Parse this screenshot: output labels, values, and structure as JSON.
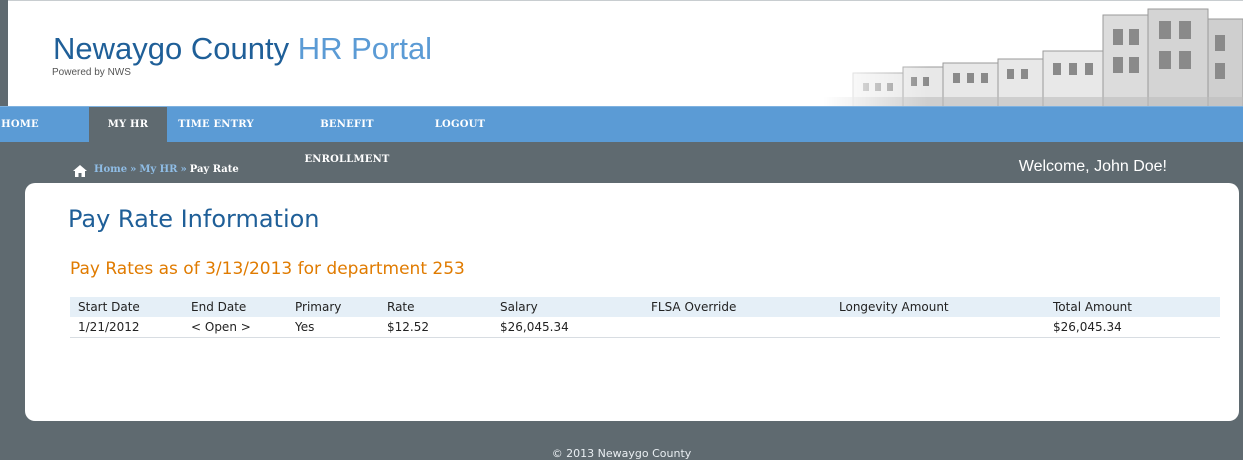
{
  "header": {
    "title_part1": "Newaygo County",
    "title_part2": "HR Portal",
    "powered_by": "Powered by NWS"
  },
  "nav": {
    "items": [
      {
        "label": "HOME"
      },
      {
        "label": "MY HR"
      },
      {
        "label": "TIME ENTRY"
      },
      {
        "label": "BENEFIT ENROLLMENT"
      },
      {
        "label": "LOGOUT"
      }
    ],
    "active": "MY HR"
  },
  "breadcrumb": {
    "home": "Home",
    "myhr": "My HR",
    "current": "Pay Rate",
    "sep": "»"
  },
  "welcome": "Welcome, John Doe!",
  "main": {
    "page_title": "Pay Rate Information",
    "section_title": "Pay Rates as of 3/13/2013 for department 253",
    "table": {
      "headers": [
        "Start Date",
        "End Date",
        "Primary",
        "Rate",
        "Salary",
        "FLSA Override",
        "Longevity Amount",
        "Total Amount"
      ],
      "rows": [
        [
          "1/21/2012",
          "< Open >",
          "Yes",
          "$12.52",
          "$26,045.34",
          "",
          "",
          "$26,045.34"
        ]
      ]
    }
  },
  "footer": "© 2013 Newaygo County",
  "colors": {
    "nav_bg": "#5b9bd5",
    "page_bg": "#5f6a70",
    "title_blue": "#1f5f98",
    "section_orange": "#e07b00"
  }
}
